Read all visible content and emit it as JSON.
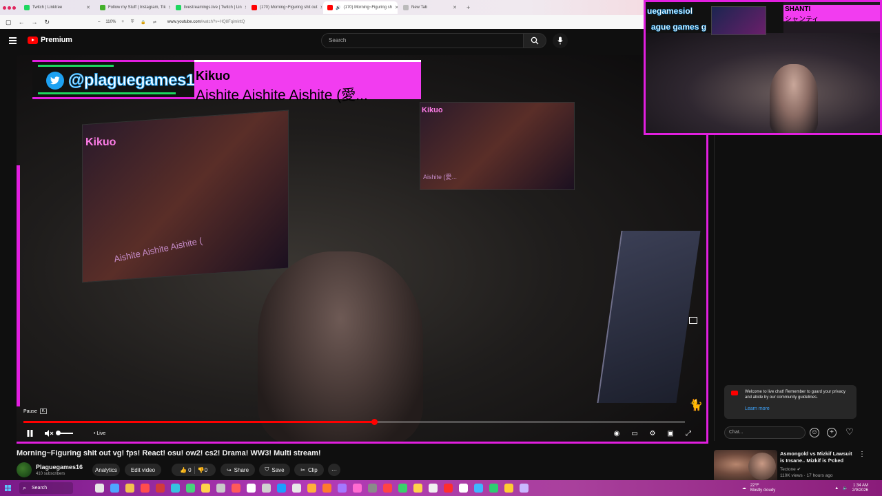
{
  "browser": {
    "tabs": [
      {
        "title": "Twitch | Linktree",
        "color": "#1ed760",
        "active": false
      },
      {
        "title": "Follow my Stuff | Instagram, Tik",
        "color": "#43b02a",
        "active": false
      },
      {
        "title": "livestreamings.live | Twitch | Lin",
        "color": "#1ed760",
        "active": false
      },
      {
        "title": "(170) Morning~Figuring shit out",
        "color": "#ff0000",
        "active": false
      },
      {
        "title": "(170) Morning~Figuring sh",
        "color": "#ff0000",
        "active": true
      },
      {
        "title": "New Tab",
        "color": "#bbbbbb",
        "active": false
      }
    ],
    "zoom": "110%",
    "url_host": "www.youtube.com",
    "url_path": "/watch?v=HQ8FqimkttQ"
  },
  "youtube": {
    "logo_text": "Premium",
    "search_placeholder": "Search"
  },
  "overlay": {
    "handle": "@plaguegames1",
    "artist": "Kikuo",
    "song": "Aishite Aishite Aishite (愛...",
    "monitor_title_left": "Kikuo",
    "monitor_sub_left": "Aishite Aishite Aishite (",
    "monitor_title_right": "Kikuo",
    "monitor_sub_right": "Aishite (愛..."
  },
  "webcam": {
    "handle_top": "uegamesiol",
    "handle_bottom": "ague games g",
    "song_artist": "SHANTI",
    "song_title": "シャンティ"
  },
  "player": {
    "pause_tooltip": "Pause",
    "pause_key": "K",
    "live_label": "• Live",
    "progress_fraction": 0.53,
    "buffered_fraction": 0.55
  },
  "video": {
    "title": "Morning~Figuring shit out vg! fps! React! osu! ow2! cs2! Drama! WW3! Multi stream!",
    "channel_name": "Plaguegames16",
    "subscribers": "410 subscribers",
    "analytics_label": "Analytics",
    "edit_label": "Edit video",
    "likes": "0",
    "dislikes": "0",
    "share_label": "Share",
    "save_label": "Save",
    "clip_label": "Clip"
  },
  "chat": {
    "notice": "Welcome to live chat! Remember to guard your privacy and abide by our community guidelines.",
    "learn_more": "Learn more",
    "input_placeholder": "Chat..."
  },
  "recommendation": {
    "title": "Asmongold vs Mizkif Lawsuit is Insane.. Mizkif is f*cked",
    "channel": "Tectone",
    "meta": "110K views · 17 hours ago"
  },
  "taskbar": {
    "search_label": "Search",
    "temperature": "22°F",
    "weather": "Mostly cloudy",
    "time": "1:34 AM",
    "date": "2/9/2026"
  },
  "colors": {
    "accent": "#e21fe0",
    "youtube_red": "#ff0000",
    "twitter_blue": "#1da1f2"
  }
}
